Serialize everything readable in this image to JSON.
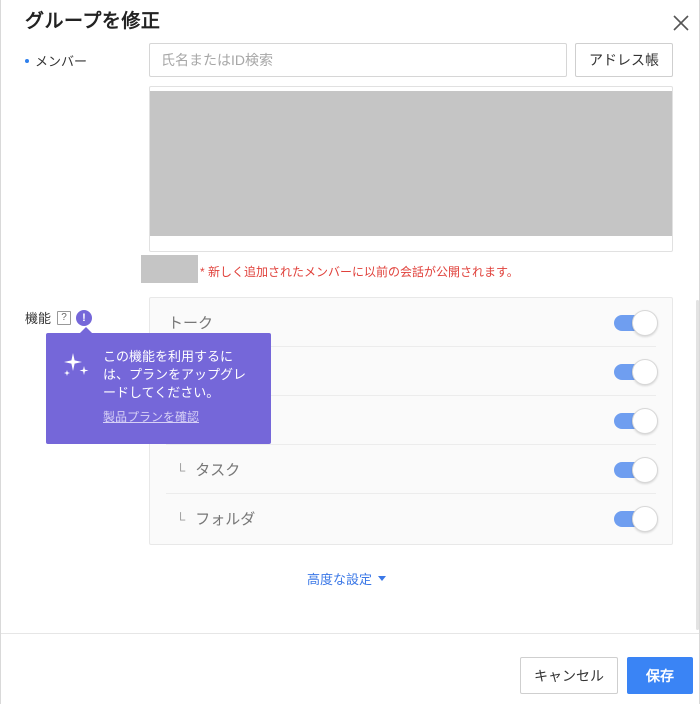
{
  "dialog": {
    "title": "グループを修正"
  },
  "members": {
    "label": "メンバー",
    "search_placeholder": "氏名またはID検索",
    "address_book_label": "アドレス帳",
    "notice": "* 新しく追加されたメンバーに以前の会話が公開されます。"
  },
  "features": {
    "label": "機能",
    "help_glyph": "?",
    "alert_glyph": "!",
    "items": [
      {
        "label": "トーク",
        "enabled": true,
        "sub": false
      },
      {
        "label": "",
        "enabled": true,
        "sub": false
      },
      {
        "label": "",
        "enabled": true,
        "sub": false
      },
      {
        "label": "タスク",
        "enabled": true,
        "sub": true
      },
      {
        "label": "フォルダ",
        "enabled": true,
        "sub": true
      }
    ],
    "sub_marker": "└"
  },
  "tooltip": {
    "text": "この機能を利用するには、プランをアップグレードしてください。",
    "link": "製品プランを確認",
    "icon": "sparkle-icon"
  },
  "advanced": {
    "label": "高度な設定"
  },
  "footer": {
    "cancel_label": "キャンセル",
    "save_label": "保存"
  },
  "colors": {
    "accent": "#3a84f5",
    "tooltip_bg": "#7567d9",
    "notice": "#e0413b",
    "toggle_on": "#6f9ef0"
  }
}
